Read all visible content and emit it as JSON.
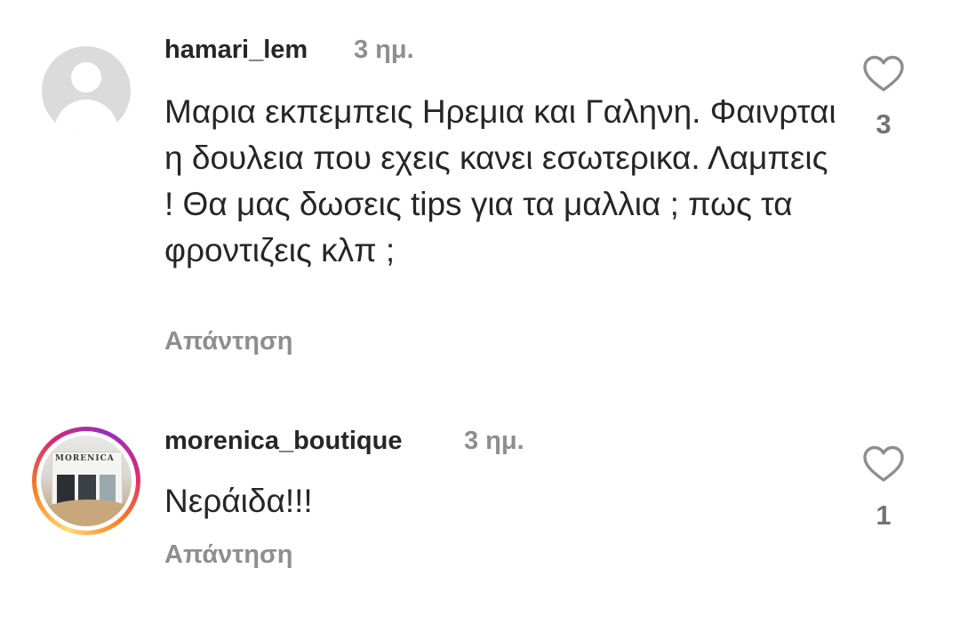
{
  "comments": [
    {
      "username": "hamari_lem",
      "time": "3 ημ.",
      "text": "Μαρια εκπεμπεις Ηρεμια και Γαληνη. Φαινρται η δουλεια που εχεις κανει εσωτερικα. Λαμπεις ! Θα μας δωσεις tips για τα μαλλια ; πως τα φροντιζεις κλπ ;",
      "reply_label": "Απάντηση",
      "likes": "3",
      "avatar": "default-avatar-icon",
      "like_icon": "heart-outline-icon"
    },
    {
      "username": "morenica_boutique",
      "time": "3 ημ.",
      "text": "Νεράιδα!!!",
      "reply_label": "Απάντηση",
      "likes": "1",
      "avatar": "story-ring-profile-photo",
      "avatar_logo_text": "MORENICA",
      "like_icon": "heart-outline-icon"
    }
  ],
  "colors": {
    "text_primary": "#262626",
    "text_secondary": "#8e8e8e",
    "like_count": "#737373",
    "story_ring": [
      "#feda75",
      "#fa7e1e",
      "#d62976",
      "#962fbf"
    ]
  }
}
